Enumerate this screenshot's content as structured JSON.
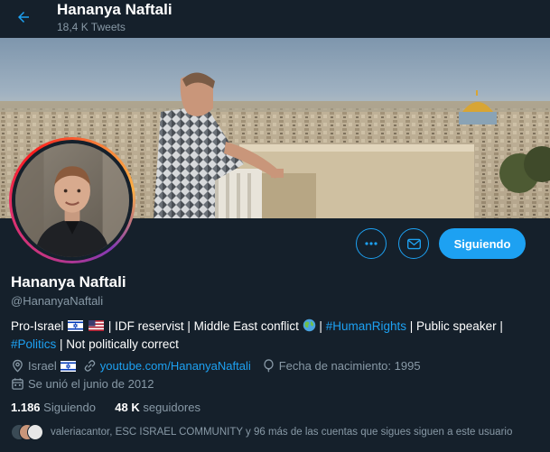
{
  "header": {
    "name": "Hananya Naftali",
    "tweet_count": "18,4 K Tweets"
  },
  "profile": {
    "name": "Hananya Naftali",
    "handle": "@HananyaNaftali",
    "bio": {
      "part1": "Pro-Israel",
      "part2": "| IDF reservist | Middle East conflict",
      "part3": "|",
      "hashtag1": "#HumanRights",
      "part4": "| Public speaker |",
      "hashtag2": "#Politics",
      "part5": "| Not politically correct"
    },
    "location": "Israel",
    "website": "youtube.com/HananyaNaftali",
    "birthday": "Fecha de nacimiento: 1995",
    "joined": "Se unió el junio de 2012"
  },
  "stats": {
    "following_count": "1.186",
    "following_label": "Siguiendo",
    "followers_count": "48 K",
    "followers_label": "seguidores"
  },
  "followers_you_know": "valeriacantor, ESC ISRAEL COMMUNITY y 96 más de las cuentas que sigues siguen a este usuario",
  "actions": {
    "follow_label": "Siguiendo"
  },
  "icons": [
    "back-arrow-icon",
    "more-icon",
    "mail-icon",
    "location-icon",
    "link-icon",
    "balloon-icon",
    "calendar-icon",
    "israel-flag-icon",
    "us-flag-icon",
    "globe-icon"
  ],
  "colors": {
    "background": "#15202b",
    "accent": "#1da1f2",
    "secondary_text": "#8899a6"
  }
}
